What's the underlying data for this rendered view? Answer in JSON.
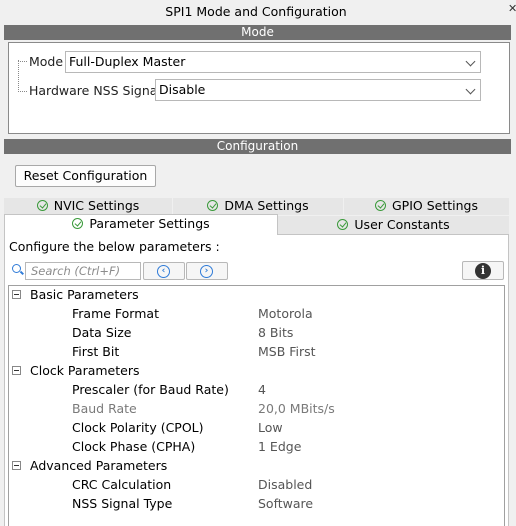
{
  "window": {
    "title": "SPI1 Mode and Configuration"
  },
  "mode": {
    "header": "Mode",
    "fields": [
      {
        "label": "Mode",
        "value": "Full-Duplex Master"
      },
      {
        "label": "Hardware NSS Signal",
        "value": "Disable"
      }
    ]
  },
  "configuration": {
    "header": "Configuration",
    "reset_label": "Reset Configuration",
    "tabs_row1": [
      "NVIC Settings",
      "DMA Settings",
      "GPIO Settings"
    ],
    "tabs_row2": [
      "Parameter Settings",
      "User Constants"
    ],
    "active_tab": "Parameter Settings",
    "instruction": "Configure the below parameters :",
    "search_placeholder": "Search (Ctrl+F)",
    "groups": [
      {
        "name": "Basic Parameters",
        "params": [
          {
            "name": "Frame Format",
            "value": "Motorola",
            "enabled": true
          },
          {
            "name": "Data Size",
            "value": "8 Bits",
            "enabled": true
          },
          {
            "name": "First Bit",
            "value": "MSB First",
            "enabled": true
          }
        ]
      },
      {
        "name": "Clock Parameters",
        "params": [
          {
            "name": "Prescaler (for Baud Rate)",
            "value": "4",
            "enabled": true
          },
          {
            "name": "Baud Rate",
            "value": "20,0 MBits/s",
            "enabled": false
          },
          {
            "name": "Clock Polarity (CPOL)",
            "value": "Low",
            "enabled": true
          },
          {
            "name": "Clock Phase (CPHA)",
            "value": "1 Edge",
            "enabled": true
          }
        ]
      },
      {
        "name": "Advanced Parameters",
        "params": [
          {
            "name": "CRC Calculation",
            "value": "Disabled",
            "enabled": true
          },
          {
            "name": "NSS Signal Type",
            "value": "Software",
            "enabled": true
          }
        ]
      }
    ]
  },
  "colors": {
    "section_bar": "#707070",
    "accent_blue": "#2f7bd8",
    "check_green": "#3a9a3a"
  },
  "icons": [
    "close-icon",
    "chevron-down-icon",
    "check-circle-icon",
    "search-icon",
    "previous-icon",
    "next-icon",
    "info-icon",
    "collapse-icon"
  ]
}
